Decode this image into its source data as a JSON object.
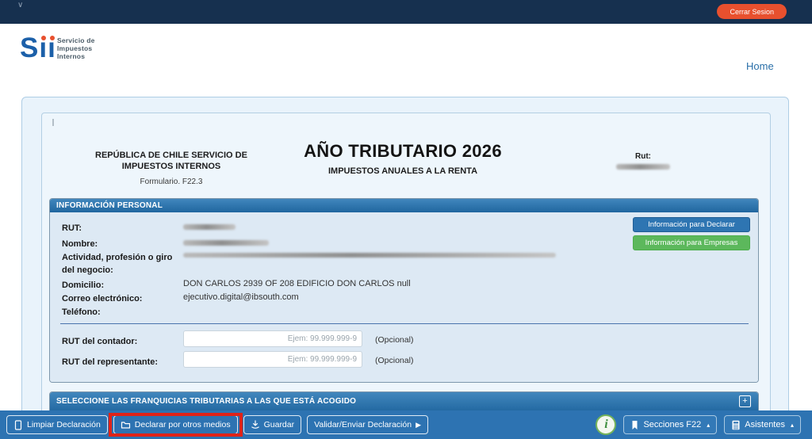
{
  "navbar": {
    "caret": "∨",
    "logout_label": "Cerrar Sesion"
  },
  "brand": {
    "logo_s": "S",
    "logo_ii": "ıı",
    "tagline_lines": [
      "Servicio de",
      "Impuestos",
      "Internos"
    ]
  },
  "nav": {
    "home": "Home"
  },
  "form_header": {
    "org_title": "REPÚBLICA DE CHILE SERVICIO DE IMPUESTOS INTERNOS",
    "form_number": "Formulario. F22.3",
    "year_title": "AÑO TRIBUTARIO 2026",
    "subtitle": "IMPUESTOS ANUALES A LA RENTA",
    "rut_label": "Rut:"
  },
  "personal_info": {
    "section_title": "INFORMACIÓN PERSONAL",
    "rut_label": "RUT:",
    "nombre_label": "Nombre:",
    "actividad_label": "Actividad, profesión o giro del negocio:",
    "domicilio_label": "Domicilio:",
    "domicilio_value": "DON CARLOS 2939 OF 208 EDIFICIO DON CARLOS null",
    "correo_label": "Correo electrónico:",
    "correo_value": "ejecutivo.digital@ibsouth.com",
    "telefono_label": "Teléfono:",
    "info_declarar_button": "Información para Declarar",
    "info_empresas_button": "Información para Empresas",
    "contador_label": "RUT del contador:",
    "contador_placeholder": "Ejem: 99.999.999-9",
    "contador_note": "(Opcional)",
    "representante_label": "RUT del representante:",
    "representante_placeholder": "Ejem: 99.999.999-9",
    "representante_note": "(Opcional)"
  },
  "franquicias": {
    "section_title": "SELECCIONE LAS FRANQUICIAS TRIBUTARIAS A LAS QUE ESTÁ ACOGIDO",
    "add_button": "+"
  },
  "toolbar": {
    "limpiar_label": "Limpiar Declaración",
    "declarar_label": "Declarar por otros medios",
    "guardar_label": "Guardar",
    "validar_label": "Validar/Enviar Declaración",
    "validar_caret": "▶",
    "info_glyph": "i",
    "secciones_label": "Secciones F22",
    "asistentes_label": "Asistentes",
    "menu_caret": "▴"
  },
  "colors": {
    "navbar_navy": "#16304f",
    "brand_orange": "#e8502e",
    "toolbar_blue": "#2d73b2",
    "section_blue": "#20669f",
    "button_green": "#5cb85c",
    "highlight_red": "#df2318"
  }
}
